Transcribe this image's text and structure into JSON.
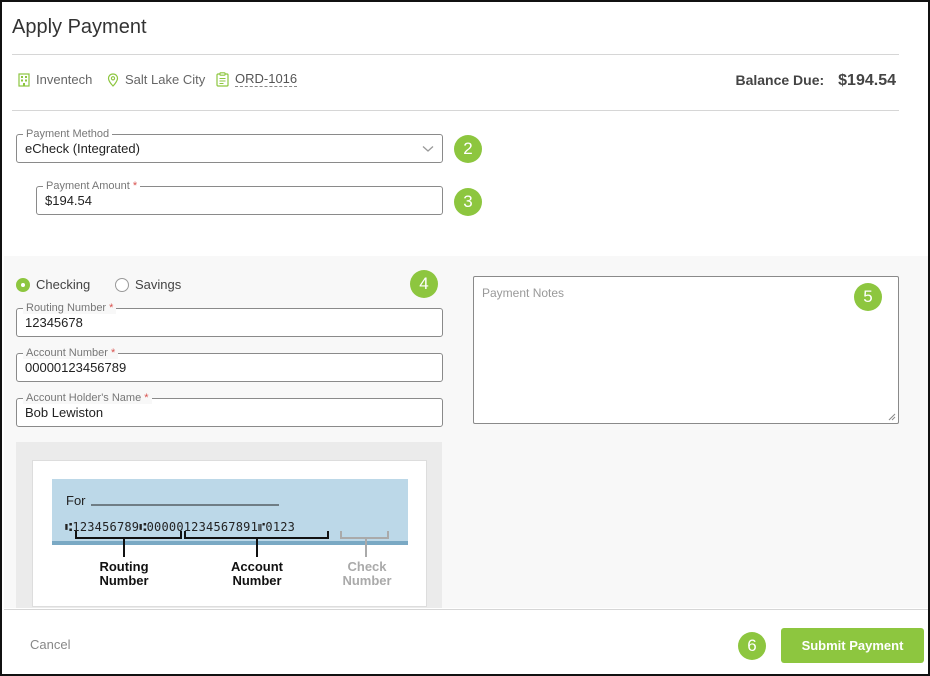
{
  "header": {
    "title": "Apply Payment",
    "company": "Inventech",
    "location": "Salt Lake City",
    "order_id": "ORD-1016",
    "balance_label": "Balance Due:",
    "balance_amount": "$194.54"
  },
  "payment_method": {
    "label": "Payment Method",
    "value": "eCheck (Integrated)",
    "step": "2"
  },
  "payment_amount": {
    "label": "Payment Amount",
    "required_mark": "*",
    "value": "$194.54",
    "step": "3"
  },
  "account_type": {
    "options": [
      "Checking",
      "Savings"
    ],
    "selected": "Checking",
    "step": "4"
  },
  "routing_number": {
    "label": "Routing Number",
    "required_mark": "*",
    "value": "12345678"
  },
  "account_number": {
    "label": "Account Number",
    "required_mark": "*",
    "value": "00000123456789"
  },
  "account_holder": {
    "label": "Account Holder's Name",
    "required_mark": "*",
    "value": "Bob Lewiston"
  },
  "notes": {
    "placeholder": "Payment Notes",
    "step": "5"
  },
  "check_illustration": {
    "for_label": "For",
    "micr_line": "⑆123456789⑆000001234567891⑈0123",
    "routing_caption": [
      "Routing",
      "Number"
    ],
    "account_caption": [
      "Account",
      "Number"
    ],
    "check_caption": [
      "Check",
      "Number"
    ]
  },
  "footer": {
    "cancel_label": "Cancel",
    "submit_label": "Submit Payment",
    "step": "6"
  },
  "colors": {
    "accent": "#8dc63f",
    "check_blue": "#bcd8e8",
    "check_stripe": "#7aa9c4"
  }
}
